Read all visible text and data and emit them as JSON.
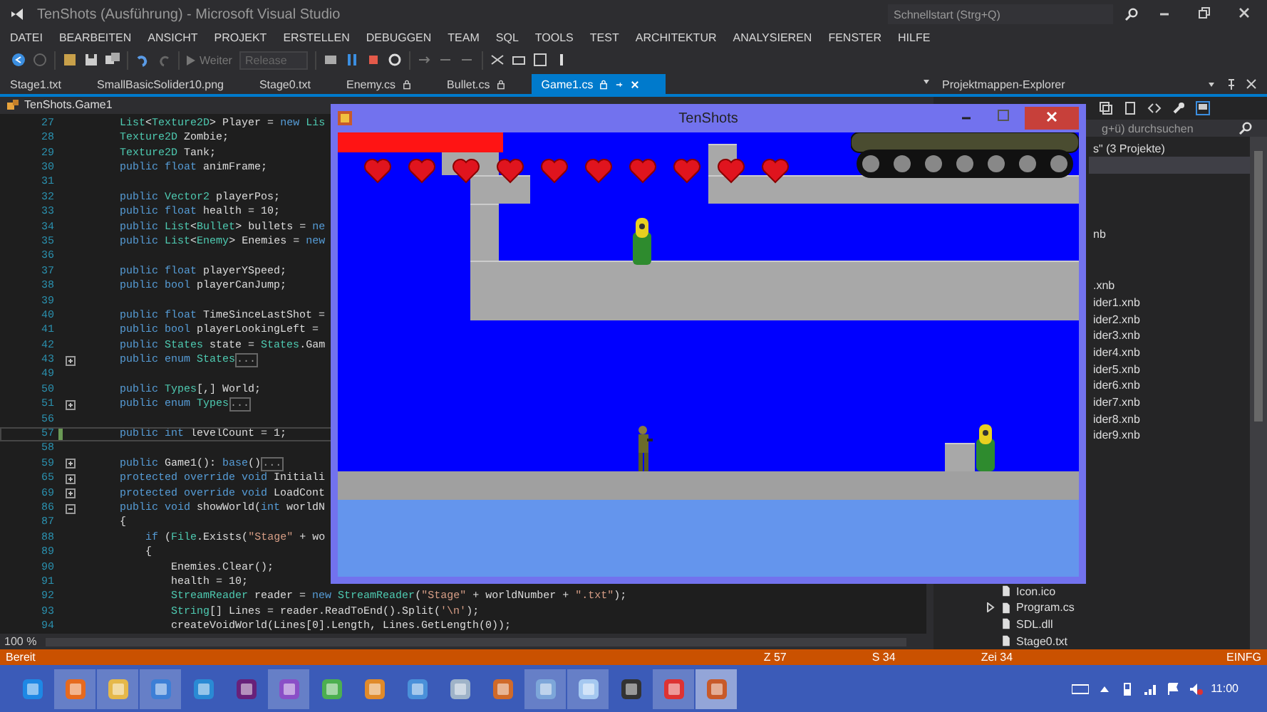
{
  "window": {
    "title": "TenShots (Ausführung) - Microsoft Visual Studio",
    "quick_launch": {
      "placeholder": "Schnellstart (Strg+Q)"
    }
  },
  "menu": [
    "DATEI",
    "BEARBEITEN",
    "ANSICHT",
    "PROJEKT",
    "ERSTELLEN",
    "DEBUGGEN",
    "TEAM",
    "SQL",
    "TOOLS",
    "TEST",
    "ARCHITEKTUR",
    "ANALYSIEREN",
    "FENSTER",
    "HILFE"
  ],
  "toolbar": {
    "continue": {
      "label": "Weiter",
      "disabled": true
    },
    "configuration": {
      "value": "Release",
      "disabled": true
    }
  },
  "tabs": [
    {
      "label": "Stage1.txt",
      "selected": false,
      "locked": false
    },
    {
      "label": "SmallBasicSolider10.png",
      "selected": false,
      "locked": false
    },
    {
      "label": "Stage0.txt",
      "selected": false,
      "locked": false
    },
    {
      "label": "Enemy.cs",
      "selected": false,
      "locked": true
    },
    {
      "label": "Bullet.cs",
      "selected": false,
      "locked": true
    },
    {
      "label": "Game1.cs",
      "selected": true,
      "locked": true
    }
  ],
  "editor": {
    "breadcrumb": "TenShots.Game1",
    "zoom": "100 %",
    "lines": [
      {
        "n": "27",
        "current": false,
        "segs": [
          {
            "kind": "ty",
            "text": "List"
          },
          {
            "kind": "tx",
            "text": "<"
          },
          {
            "kind": "ty",
            "text": "Texture2D"
          },
          {
            "kind": "tx",
            "text": "> Player = "
          },
          {
            "kind": "kw",
            "text": "new"
          },
          {
            "kind": "ty",
            "text": " Lis"
          }
        ]
      },
      {
        "n": "28",
        "current": false,
        "segs": [
          {
            "kind": "ty",
            "text": "Texture2D"
          },
          {
            "kind": "tx",
            "text": " Zombie;"
          }
        ]
      },
      {
        "n": "29",
        "current": false,
        "segs": [
          {
            "kind": "ty",
            "text": "Texture2D"
          },
          {
            "kind": "tx",
            "text": " Tank;"
          }
        ]
      },
      {
        "n": "30",
        "current": false,
        "segs": [
          {
            "kind": "kw",
            "text": "public float"
          },
          {
            "kind": "tx",
            "text": " animFrame;"
          }
        ]
      },
      {
        "n": "31",
        "current": false
      },
      {
        "n": "32",
        "current": false,
        "segs": [
          {
            "kind": "kw",
            "text": "public "
          },
          {
            "kind": "ty",
            "text": "Vector2"
          },
          {
            "kind": "tx",
            "text": " playerPos;"
          }
        ]
      },
      {
        "n": "33",
        "current": false,
        "segs": [
          {
            "kind": "kw",
            "text": "public float"
          },
          {
            "kind": "tx",
            "text": " health = 10;"
          }
        ]
      },
      {
        "n": "34",
        "current": false,
        "segs": [
          {
            "kind": "kw",
            "text": "public "
          },
          {
            "kind": "ty",
            "text": "List"
          },
          {
            "kind": "tx",
            "text": "<"
          },
          {
            "kind": "ty",
            "text": "Bullet"
          },
          {
            "kind": "tx",
            "text": "> bullets = "
          },
          {
            "kind": "kw",
            "text": "ne"
          }
        ]
      },
      {
        "n": "35",
        "current": false,
        "segs": [
          {
            "kind": "kw",
            "text": "public "
          },
          {
            "kind": "ty",
            "text": "List"
          },
          {
            "kind": "tx",
            "text": "<"
          },
          {
            "kind": "ty",
            "text": "Enemy"
          },
          {
            "kind": "tx",
            "text": "> Enemies = "
          },
          {
            "kind": "kw",
            "text": "new"
          }
        ]
      },
      {
        "n": "36",
        "current": false
      },
      {
        "n": "37",
        "current": false,
        "segs": [
          {
            "kind": "kw",
            "text": "public float"
          },
          {
            "kind": "tx",
            "text": " playerYSpeed;"
          }
        ]
      },
      {
        "n": "38",
        "current": false,
        "segs": [
          {
            "kind": "kw",
            "text": "public bool"
          },
          {
            "kind": "tx",
            "text": " playerCanJump;"
          }
        ]
      },
      {
        "n": "39",
        "current": false
      },
      {
        "n": "40",
        "current": false,
        "segs": [
          {
            "kind": "kw",
            "text": "public float"
          },
          {
            "kind": "tx",
            "text": " TimeSinceLastShot ="
          }
        ]
      },
      {
        "n": "41",
        "current": false,
        "segs": [
          {
            "kind": "kw",
            "text": "public bool"
          },
          {
            "kind": "tx",
            "text": " playerLookingLeft ="
          }
        ]
      },
      {
        "n": "42",
        "current": false,
        "segs": [
          {
            "kind": "kw",
            "text": "public "
          },
          {
            "kind": "ty",
            "text": "States"
          },
          {
            "kind": "tx",
            "text": " state = "
          },
          {
            "kind": "ty",
            "text": "States"
          },
          {
            "kind": "tx",
            "text": ".Gam"
          }
        ]
      },
      {
        "n": "43",
        "current": false,
        "folded": true,
        "segs": [
          {
            "kind": "kw",
            "text": "public enum "
          },
          {
            "kind": "ty",
            "text": "States"
          },
          {
            "kind": "fold",
            "text": "..."
          }
        ]
      },
      {
        "n": "49",
        "current": false
      },
      {
        "n": "50",
        "current": false,
        "segs": [
          {
            "kind": "kw",
            "text": "public "
          },
          {
            "kind": "ty",
            "text": "Types"
          },
          {
            "kind": "tx",
            "text": "[,] World;"
          }
        ]
      },
      {
        "n": "51",
        "current": false,
        "folded": true,
        "segs": [
          {
            "kind": "kw",
            "text": "public enum "
          },
          {
            "kind": "ty",
            "text": "Types"
          },
          {
            "kind": "fold",
            "text": "..."
          }
        ]
      },
      {
        "n": "56",
        "current": false
      },
      {
        "n": "57",
        "current": true,
        "segs": [
          {
            "kind": "kw",
            "text": "public int"
          },
          {
            "kind": "tx",
            "text": " levelCount = 1;"
          }
        ]
      },
      {
        "n": "58",
        "current": false
      },
      {
        "n": "59",
        "current": false,
        "folded": true,
        "segs": [
          {
            "kind": "kw",
            "text": "public "
          },
          {
            "kind": "tx",
            "text": "Game1(): "
          },
          {
            "kind": "kw",
            "text": "base"
          },
          {
            "kind": "tx",
            "text": "()"
          },
          {
            "kind": "fold",
            "text": "..."
          }
        ]
      },
      {
        "n": "65",
        "current": false,
        "folded": true,
        "segs": [
          {
            "kind": "kw",
            "text": "protected override void"
          },
          {
            "kind": "tx",
            "text": " Initiali"
          }
        ]
      },
      {
        "n": "69",
        "current": false,
        "folded": true,
        "segs": [
          {
            "kind": "kw",
            "text": "protected override void"
          },
          {
            "kind": "tx",
            "text": " LoadCont"
          }
        ]
      },
      {
        "n": "86",
        "current": false,
        "folded": false,
        "segs": [
          {
            "kind": "kw",
            "text": "public void"
          },
          {
            "kind": "tx",
            "text": " showWorld("
          },
          {
            "kind": "kw",
            "text": "int"
          },
          {
            "kind": "tx",
            "text": " worldN"
          }
        ]
      },
      {
        "n": "87",
        "current": false,
        "segs": [
          {
            "kind": "tx",
            "text": "{"
          }
        ]
      },
      {
        "n": "88",
        "current": false,
        "segs": [
          {
            "kind": "kw",
            "text": "    if"
          },
          {
            "kind": "tx",
            "text": " ("
          },
          {
            "kind": "ty",
            "text": "File"
          },
          {
            "kind": "tx",
            "text": ".Exists("
          },
          {
            "kind": "st",
            "text": "\"Stage\""
          },
          {
            "kind": "tx",
            "text": " + wo"
          }
        ]
      },
      {
        "n": "89",
        "current": false,
        "segs": [
          {
            "kind": "tx",
            "text": "    {"
          }
        ]
      },
      {
        "n": "90",
        "current": false,
        "segs": [
          {
            "kind": "tx",
            "text": "        Enemies.Clear();"
          }
        ]
      },
      {
        "n": "91",
        "current": false,
        "segs": [
          {
            "kind": "tx",
            "text": "        health = 10;"
          }
        ]
      },
      {
        "n": "92",
        "current": false,
        "segs": [
          {
            "kind": "ty",
            "text": "        StreamReader"
          },
          {
            "kind": "tx",
            "text": " reader = "
          },
          {
            "kind": "kw",
            "text": "new "
          },
          {
            "kind": "ty",
            "text": "StreamReader"
          },
          {
            "kind": "tx",
            "text": "("
          },
          {
            "kind": "st",
            "text": "\"Stage\""
          },
          {
            "kind": "tx",
            "text": " + worldNumber + "
          },
          {
            "kind": "st",
            "text": "\".txt\""
          },
          {
            "kind": "tx",
            "text": ");"
          }
        ]
      },
      {
        "n": "93",
        "current": false,
        "segs": [
          {
            "kind": "ty",
            "text": "        String"
          },
          {
            "kind": "tx",
            "text": "[] Lines = reader.ReadToEnd().Split("
          },
          {
            "kind": "st",
            "text": "'\\n'"
          },
          {
            "kind": "tx",
            "text": ");"
          }
        ]
      },
      {
        "n": "94",
        "current": false,
        "segs": [
          {
            "kind": "tx",
            "text": "        createVoidWorld(Lines[0].Length, Lines.GetLength(0));"
          }
        ]
      }
    ]
  },
  "explorer": {
    "title": "Projektmappen-Explorer",
    "search": {
      "placeholder": "g+ü) durchsuchen"
    },
    "rows": [
      {
        "kind": "clipped",
        "text": "s\" (3 Projekte)",
        "selected": false
      },
      {
        "kind": "spacer",
        "selected": true
      },
      {
        "kind": "spacer",
        "selected": false
      },
      {
        "kind": "spacer",
        "selected": false
      },
      {
        "kind": "spacer",
        "selected": false
      },
      {
        "kind": "clipped",
        "text": "nb",
        "selected": false
      },
      {
        "kind": "spacer",
        "selected": false
      },
      {
        "kind": "spacer",
        "selected": false
      },
      {
        "kind": "clipped",
        "text": ".xnb",
        "selected": false
      },
      {
        "kind": "clipped",
        "text": "ider1.xnb",
        "selected": false
      },
      {
        "kind": "clipped",
        "text": "ider2.xnb",
        "selected": false
      },
      {
        "kind": "clipped",
        "text": "ider3.xnb",
        "selected": false
      },
      {
        "kind": "clipped",
        "text": "ider4.xnb",
        "selected": false
      },
      {
        "kind": "clipped",
        "text": "ider5.xnb",
        "selected": false
      },
      {
        "kind": "clipped",
        "text": "ider6.xnb",
        "selected": false
      },
      {
        "kind": "clipped",
        "text": "ider7.xnb",
        "selected": false
      },
      {
        "kind": "clipped",
        "text": "ider8.xnb",
        "selected": false
      },
      {
        "kind": "clipped",
        "text": "ider9.xnb",
        "selected": false
      },
      {
        "kind": "spacer",
        "selected": false
      },
      {
        "kind": "spacer",
        "selected": false
      },
      {
        "kind": "spacer",
        "selected": false
      },
      {
        "kind": "spacer",
        "selected": false
      },
      {
        "kind": "spacer",
        "selected": false
      },
      {
        "kind": "spacer",
        "selected": false
      },
      {
        "kind": "spacer",
        "selected": false
      },
      {
        "kind": "spacer",
        "selected": false
      },
      {
        "kind": "file",
        "text": "Icon.ico",
        "selected": false,
        "expandable": false
      },
      {
        "kind": "file",
        "text": "Program.cs",
        "selected": false,
        "expandable": true
      },
      {
        "kind": "file",
        "text": "SDL.dll",
        "selected": false,
        "expandable": false
      },
      {
        "kind": "file",
        "text": "Stage0.txt",
        "selected": false,
        "expandable": false
      }
    ]
  },
  "game_window": {
    "title": "TenShots",
    "hearts": [
      {
        "filled": true
      },
      {
        "filled": true
      },
      {
        "filled": true
      },
      {
        "filled": true
      },
      {
        "filled": true
      },
      {
        "filled": true
      },
      {
        "filled": true
      },
      {
        "filled": true
      },
      {
        "filled": true
      },
      {
        "filled": true
      }
    ]
  },
  "status_bar": {
    "message": "Bereit",
    "line": "Z 57",
    "column": "S 34",
    "char": "Zei 34",
    "mode": "EINFG"
  },
  "taskbar": {
    "buttons": [
      {
        "selected": false,
        "running": false
      },
      {
        "selected": false,
        "running": true
      },
      {
        "selected": false,
        "running": true
      },
      {
        "selected": false,
        "running": true
      },
      {
        "selected": false,
        "running": false
      },
      {
        "selected": false,
        "running": false
      },
      {
        "selected": false,
        "running": true
      },
      {
        "selected": false,
        "running": false
      },
      {
        "selected": false,
        "running": false
      },
      {
        "selected": false,
        "running": false
      },
      {
        "selected": false,
        "running": false
      },
      {
        "selected": false,
        "running": false
      },
      {
        "selected": false,
        "running": true
      },
      {
        "selected": false,
        "running": true
      },
      {
        "selected": false,
        "running": false
      },
      {
        "selected": false,
        "running": true
      },
      {
        "selected": true,
        "running": true
      }
    ],
    "clock": "11:00"
  }
}
